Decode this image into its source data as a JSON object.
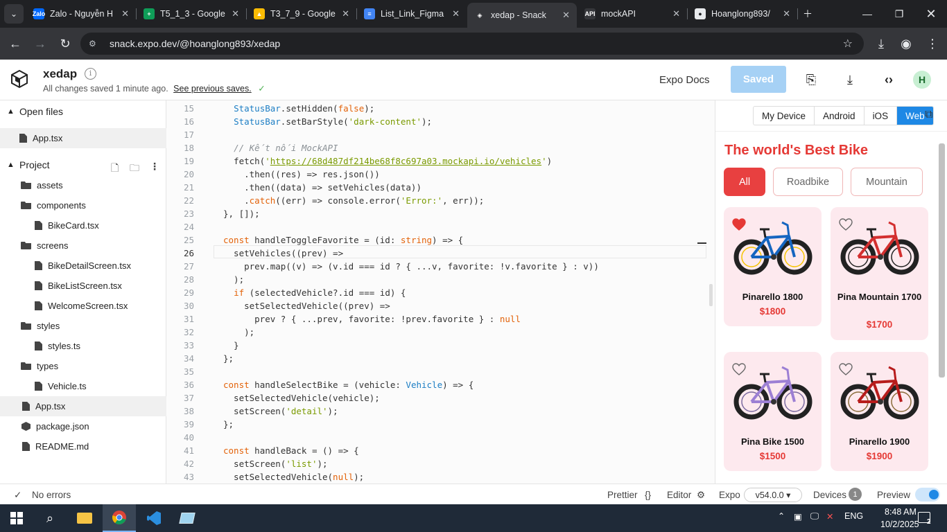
{
  "browser": {
    "tabs": [
      {
        "title": "Zalo - Nguyễn H",
        "icon": "zalo-icon",
        "color": "#0068ff",
        "letter": "Zalo"
      },
      {
        "title": "T5_1_3 - Google",
        "icon": "sheets-icon",
        "color": "#0f9d58",
        "letter": "+"
      },
      {
        "title": "T3_7_9 - Google",
        "icon": "drive-icon",
        "color": "#fbbc04",
        "letter": "▲"
      },
      {
        "title": "List_Link_Figma",
        "icon": "docs-icon",
        "color": "#4285f4",
        "letter": "≡"
      },
      {
        "title": "xedap - Snack",
        "icon": "snack-icon",
        "color": "#35363a",
        "letter": "◈",
        "active": true
      },
      {
        "title": "mockAPI",
        "icon": "mockapi-icon",
        "color": "#35363a",
        "letter": "API"
      },
      {
        "title": "Hoanglong893/",
        "icon": "github-icon",
        "color": "#e8eaed",
        "letter": "●"
      }
    ],
    "url": "snack.expo.dev/@hoanglong893/xedap"
  },
  "header": {
    "project_name": "xedap",
    "saved_status": "All changes saved 1 minute ago.",
    "previous_saves_link": "See previous saves.",
    "docs_link": "Expo Docs",
    "saved_button": "Saved",
    "avatar_letter": "H"
  },
  "sidebar": {
    "open_files_label": "Open files",
    "open_files": [
      "App.tsx"
    ],
    "project_label": "Project",
    "tree": [
      {
        "name": "assets",
        "type": "folder",
        "depth": 0
      },
      {
        "name": "components",
        "type": "folder",
        "depth": 0
      },
      {
        "name": "BikeCard.tsx",
        "type": "file",
        "depth": 1
      },
      {
        "name": "screens",
        "type": "folder",
        "depth": 0
      },
      {
        "name": "BikeDetailScreen.tsx",
        "type": "file",
        "depth": 1
      },
      {
        "name": "BikeListScreen.tsx",
        "type": "file",
        "depth": 1
      },
      {
        "name": "WelcomeScreen.tsx",
        "type": "file",
        "depth": 1
      },
      {
        "name": "styles",
        "type": "folder",
        "depth": 0
      },
      {
        "name": "styles.ts",
        "type": "file",
        "depth": 1
      },
      {
        "name": "types",
        "type": "folder",
        "depth": 0
      },
      {
        "name": "Vehicle.ts",
        "type": "file",
        "depth": 1
      },
      {
        "name": "App.tsx",
        "type": "file",
        "depth": 0,
        "selected": true
      },
      {
        "name": "package.json",
        "type": "package",
        "depth": 0
      },
      {
        "name": "README.md",
        "type": "file",
        "depth": 0
      }
    ]
  },
  "editor": {
    "line_numbers": [
      "15",
      "16",
      "17",
      "18",
      "19",
      "20",
      "21",
      "22",
      "23",
      "24",
      "25",
      "26",
      "27",
      "28",
      "29",
      "30",
      "31",
      "32",
      "33",
      "34",
      "35",
      "36",
      "37",
      "38",
      "39",
      "40",
      "41",
      "42",
      "43"
    ],
    "current_line": "26",
    "lines": [
      "  <span class='t'>StatusBar</span>.setHidden(<span class='k'>false</span>);",
      "  <span class='t'>StatusBar</span>.setBarStyle(<span class='s'>'dark-content'</span>);",
      "",
      "  <span class='cm'>// Kết nối MockAPI</span>",
      "  fetch(<span class='s'>'</span><span class='u'>https://68d487df214be68f8c697a03.mockapi.io/vehicles</span><span class='s'>'</span>)",
      "    .then((res) =&gt; res.json())",
      "    .then((data) =&gt; setVehicles(data))",
      "    .<span class='k'>catch</span>((err) =&gt; console.error(<span class='s'>'Error:'</span>, err));",
      "}, []);",
      "",
      "<span class='k'>const</span> handleToggleFavorite = (id: <span class='k'>string</span>) =&gt; {",
      "  setVehicles((prev) =&gt;",
      "    prev.map((v) =&gt; (v.id === id ? { ...v, favorite: !v.favorite } : v))",
      "  );",
      "  <span class='k'>if</span> (selectedVehicle?.id === id) {",
      "    setSelectedVehicle((prev) =&gt;",
      "      prev ? { ...prev, favorite: !prev.favorite } : <span class='k'>null</span>",
      "    );",
      "  }",
      "};",
      "",
      "<span class='k'>const</span> handleSelectBike = (vehicle: <span class='t'>Vehicle</span>) =&gt; {",
      "  setSelectedVehicle(vehicle);",
      "  setScreen(<span class='s'>'detail'</span>);",
      "};",
      "",
      "<span class='k'>const</span> handleBack = () =&gt; {",
      "  setScreen(<span class='s'>'list'</span>);",
      "  setSelectedVehicle(<span class='k'>null</span>);"
    ]
  },
  "preview": {
    "device_tabs": [
      "My Device",
      "Android",
      "iOS",
      "Web"
    ],
    "active_device": "Web",
    "app_title": "The world's Best Bike",
    "categories": [
      "All",
      "Roadbike",
      "Mountain"
    ],
    "active_category": "All",
    "bikes": [
      {
        "name": "Pinarello 1800",
        "price": "$1800",
        "favorite": true,
        "frame_color": "#1565c0",
        "accent": "#f5c400"
      },
      {
        "name": "Pina Mountain 1700",
        "price": "$1700",
        "favorite": false,
        "frame_color": "#d32f2f",
        "accent": "#222"
      },
      {
        "name": "Pina Bike 1500",
        "price": "$1500",
        "favorite": false,
        "frame_color": "#9c7fd4",
        "accent": "#7a6aa0"
      },
      {
        "name": "Pinarello 1900",
        "price": "$1900",
        "favorite": false,
        "frame_color": "#b71c1c",
        "accent": "#8a6d3b"
      }
    ]
  },
  "status_bar": {
    "errors": "No errors",
    "prettier": "Prettier",
    "editor": "Editor",
    "expo": "Expo",
    "sdk_version": "v54.0.0",
    "devices": "Devices",
    "devices_count": "1",
    "preview": "Preview"
  },
  "taskbar": {
    "lang": "ENG",
    "time": "8:48 AM",
    "date": "10/2/2025",
    "notifications": "2"
  },
  "colors": {
    "accent": "#1e88e5",
    "brand_red": "#e53935"
  }
}
